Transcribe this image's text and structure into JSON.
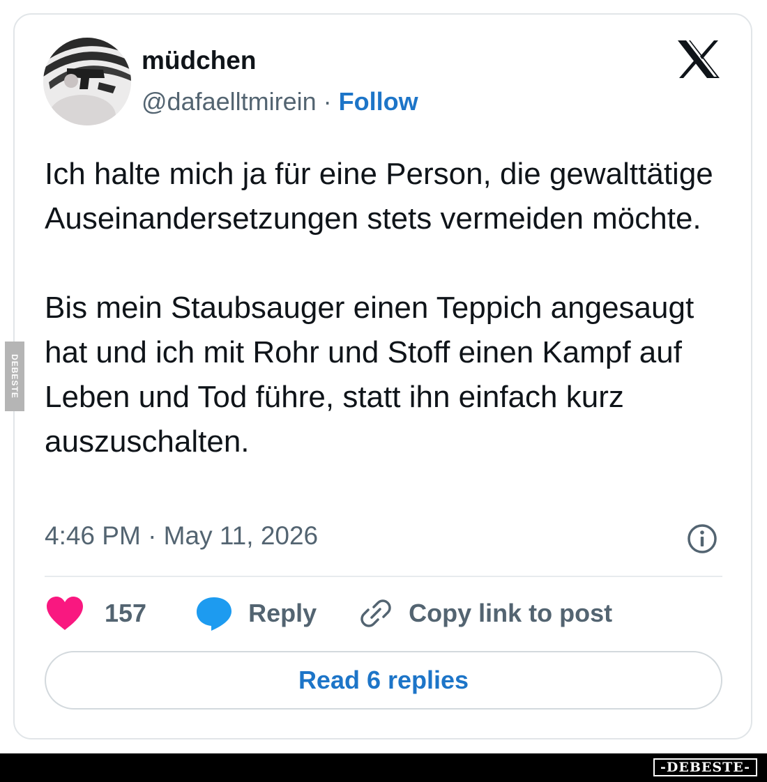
{
  "author": {
    "display_name": "müdchen",
    "handle": "@dafaelltmirein",
    "separator": " · ",
    "follow_label": "Follow"
  },
  "tweet": {
    "paragraphs": [
      "Ich halte mich ja für eine Person, die gewalttätige Auseinandersetzungen stets vermeiden möchte.",
      "Bis mein Staubsauger einen Teppich angesaugt hat und ich mit Rohr und Stoff einen Kampf auf Leben und Tod führe, statt ihn einfach kurz auszuschalten."
    ],
    "timestamp": "4:46 PM · May 11, 2026"
  },
  "actions": {
    "likes": "157",
    "reply_label": "Reply",
    "copy_label": "Copy link to post",
    "read_replies_label": "Read 6 replies"
  },
  "watermarks": {
    "side": "DEBESTE",
    "brand": "-DEBESTE-"
  },
  "icons": {
    "platform_logo": "x-logo-icon",
    "info": "info-icon",
    "like": "heart-icon",
    "reply": "speech-bubble-icon",
    "copy": "link-icon"
  },
  "colors": {
    "like": "#f91880",
    "reply": "#1d9bf0",
    "link": "#1d75c8",
    "muted_text": "#536471"
  }
}
